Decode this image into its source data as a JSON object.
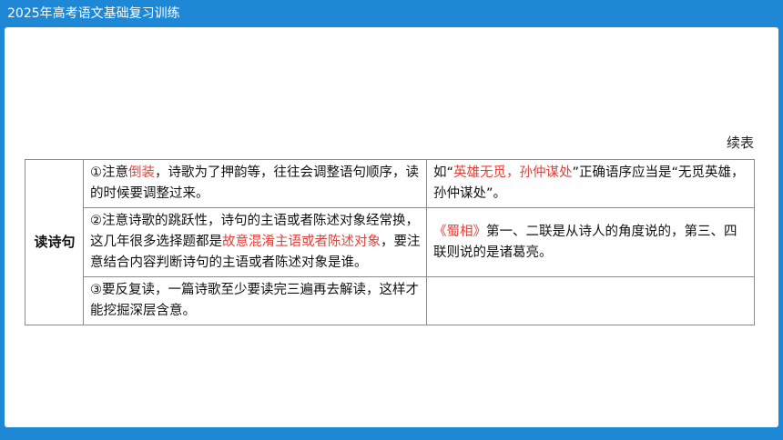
{
  "header": {
    "title": "2025年高考语文基础复习训练"
  },
  "continuation_label": "续表",
  "table": {
    "row_header": "读诗句",
    "rows": [
      {
        "left": [
          {
            "text": "①注意",
            "highlight": false
          },
          {
            "text": "倒装",
            "highlight": true
          },
          {
            "text": "，诗歌为了押韵等，往往会调整语句顺序，读的时候要调整过来。",
            "highlight": false
          }
        ],
        "right": [
          {
            "text": "如“",
            "highlight": false
          },
          {
            "text": "英雄无觅，孙仲谋处",
            "highlight": true
          },
          {
            "text": "”正确语序应当是“无觅英雄，孙仲谋处”。",
            "highlight": false
          }
        ]
      },
      {
        "left": [
          {
            "text": "②注意诗歌的跳跃性，诗句的主语或者陈述对象经常换，这几年很多选择题都是",
            "highlight": false
          },
          {
            "text": "故意混淆主语或者陈述对象",
            "highlight": true
          },
          {
            "text": "，要注意结合内容判断诗句的主语或者陈述对象是谁。",
            "highlight": false
          }
        ],
        "right": [
          {
            "text": "《蜀相》",
            "highlight": true
          },
          {
            "text": "第一、二联是从诗人的角度说的，第三、四联则说的是诸葛亮。",
            "highlight": false
          }
        ]
      },
      {
        "left": [
          {
            "text": "③要反复读，一篇诗歌至少要读完三遍再去解读，这样才能挖掘深层含意。",
            "highlight": false
          }
        ],
        "right": []
      }
    ]
  },
  "colors": {
    "accent_blue": "#1e88d6",
    "highlight_red": "#e0413a"
  }
}
